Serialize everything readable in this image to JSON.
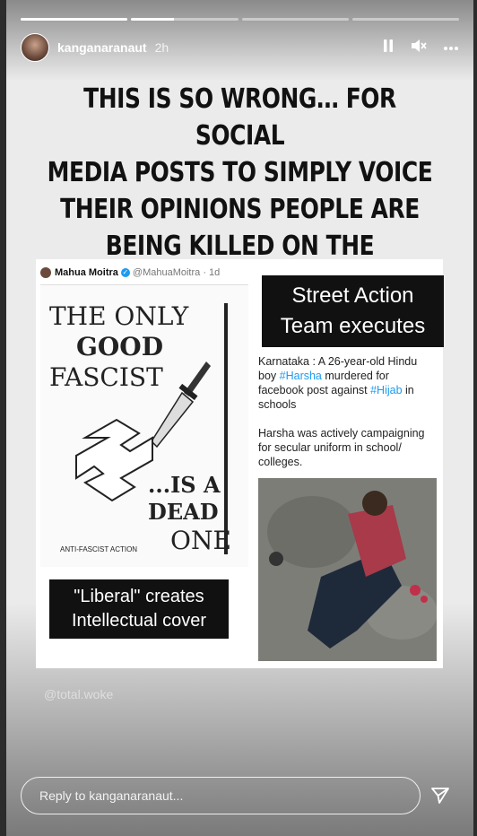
{
  "header": {
    "username": "kanganaranaut",
    "time": "2h",
    "progress": [
      1,
      0.4,
      0,
      0
    ],
    "controls": [
      "pause-icon",
      "mute-icon",
      "more-icon"
    ]
  },
  "headline": {
    "line1": "THIS IS SO WRONG… FOR SOCIAL",
    "line2": "MEDIA POSTS TO SIMPLY VOICE",
    "line3": "THEIR OPINIONS PEOPLE ARE",
    "line4": "BEING KILLED ON THE STREETS…"
  },
  "tweet": {
    "name": "Mahua Moitra",
    "handle": "@MahuaMoitra · 1d"
  },
  "poster": {
    "line1": "THE ONLY",
    "line2": "GOOD",
    "line3": "FASCIST",
    "line4": "...IS A",
    "line5": "DEAD",
    "line6": "ONE",
    "footer": "ANTI-FASCIST ACTION"
  },
  "labels": {
    "liberal1": "\"Liberal\" creates",
    "liberal2": "Intellectual cover",
    "street1": "Street Action",
    "street2": "Team executes"
  },
  "news": {
    "p1_a": "Karnataka : A 26-year-old Hindu boy ",
    "p1_hash1": "#Harsha",
    "p1_b": " murdered for facebook post against ",
    "p1_hash2": "#Hijab",
    "p1_c": " in schools",
    "p2": "Harsha was actively campaigning for secular uniform in school/ colleges."
  },
  "watermark": "@total.woke",
  "reply": {
    "placeholder": "Reply to kanganaranaut..."
  },
  "colors": {
    "accent": "#1d9bf0",
    "label_bg": "#111111"
  }
}
